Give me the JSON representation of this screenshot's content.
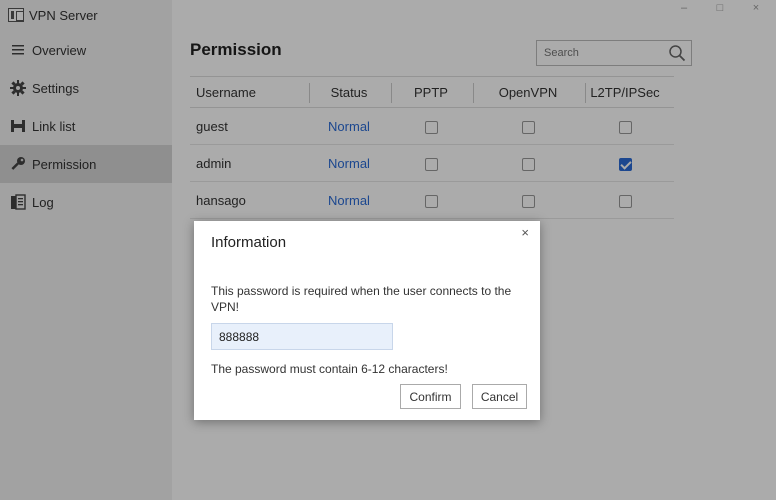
{
  "window": {
    "title": "VPN Server",
    "controls": {
      "minimize": "–",
      "maximize": "□",
      "close": "×"
    }
  },
  "sidebar": {
    "items": [
      {
        "label": "Overview",
        "icon": "menu-icon"
      },
      {
        "label": "Settings",
        "icon": "gear-icon"
      },
      {
        "label": "Link list",
        "icon": "network-icon"
      },
      {
        "label": "Permission",
        "icon": "key-icon",
        "active": true
      },
      {
        "label": "Log",
        "icon": "document-icon"
      }
    ]
  },
  "main": {
    "title": "Permission",
    "search": {
      "placeholder": "Search"
    },
    "table": {
      "headers": [
        "Username",
        "Status",
        "PPTP",
        "OpenVPN",
        "L2TP/IPSec"
      ],
      "rows": [
        {
          "username": "guest",
          "status": "Normal",
          "pptp": false,
          "openvpn": false,
          "l2tp": false
        },
        {
          "username": "admin",
          "status": "Normal",
          "pptp": false,
          "openvpn": false,
          "l2tp": true
        },
        {
          "username": "hansago",
          "status": "Normal",
          "pptp": false,
          "openvpn": false,
          "l2tp": false
        }
      ]
    }
  },
  "dialog": {
    "title": "Information",
    "close": "×",
    "message": "This password is required when the user connects to the VPN!",
    "password_value": "888888",
    "hint": "The password must contain 6-12 characters!",
    "confirm_label": "Confirm",
    "cancel_label": "Cancel"
  },
  "colors": {
    "accent": "#2a6bd6",
    "sidebar_bg": "#f2f2f2",
    "sidebar_active": "#d5d5d5"
  }
}
